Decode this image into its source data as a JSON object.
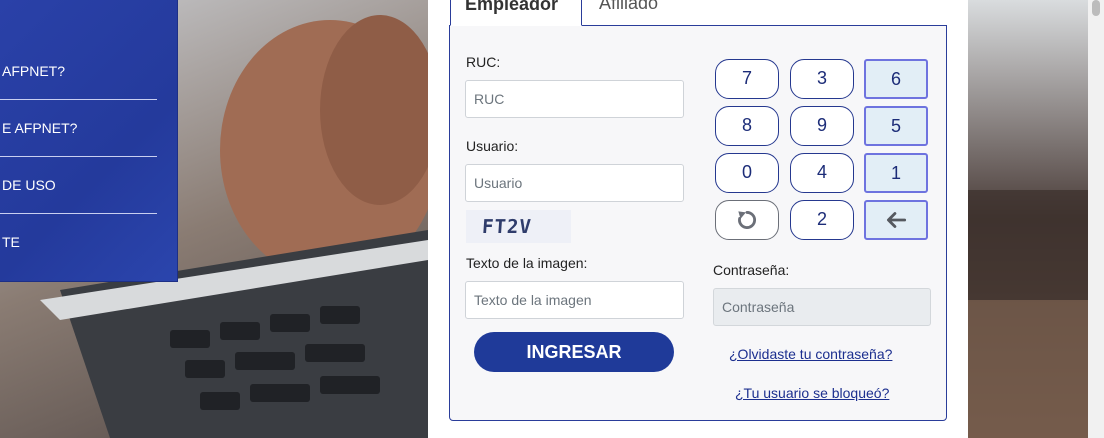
{
  "side_menu": {
    "items": [
      "AFPNET?",
      "E AFPNET?",
      "DE USO",
      "TE"
    ]
  },
  "tabs": {
    "employer": "Empleador",
    "affiliate": "Afiliado"
  },
  "form": {
    "ruc_label": "RUC:",
    "ruc_placeholder": "RUC",
    "user_label": "Usuario:",
    "user_placeholder": "Usuario",
    "captcha_text": "FT2V",
    "image_text_label": "Texto de la imagen:",
    "image_text_placeholder": "Texto de la imagen",
    "password_label": "Contraseña:",
    "password_placeholder": "Contraseña",
    "login_button": "INGRESAR"
  },
  "keypad": {
    "row1": [
      "7",
      "3",
      "6"
    ],
    "row2": [
      "8",
      "9",
      "5"
    ],
    "row3": [
      "0",
      "4",
      "1"
    ],
    "row4": [
      "",
      "2",
      ""
    ]
  },
  "links": {
    "forgot_password": "¿Olvidaste tu contraseña?",
    "user_blocked": "¿Tu usuario se bloqueó?"
  },
  "icons": {
    "reset": "refresh-icon",
    "backspace": "arrow-left-icon"
  }
}
